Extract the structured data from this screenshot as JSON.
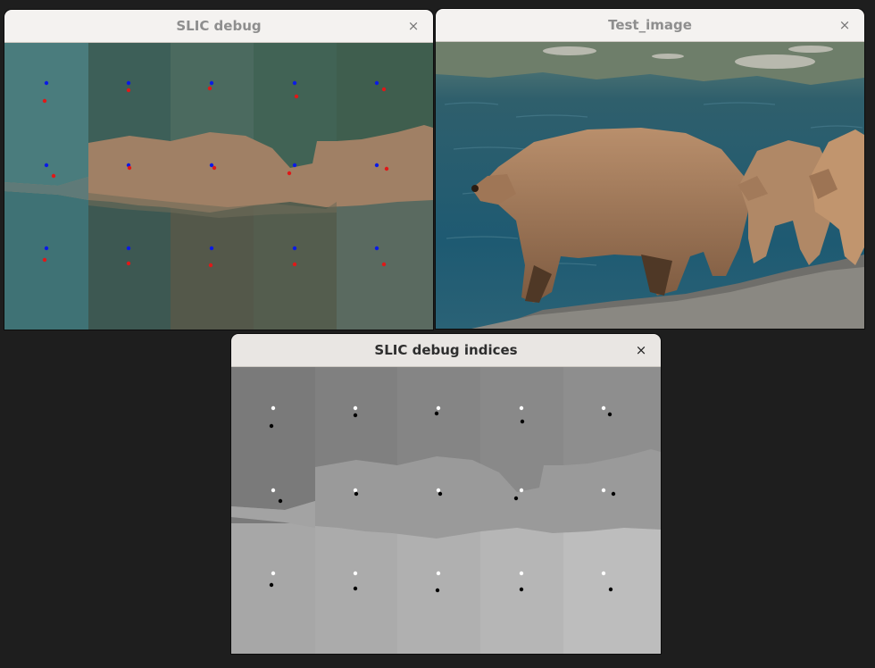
{
  "windows": [
    {
      "id": "slic-debug",
      "title": "SLIC debug",
      "close_glyph": "×",
      "close_icon": "close-icon"
    },
    {
      "id": "test-image",
      "title": "Test_image",
      "close_glyph": "×",
      "close_icon": "close-icon"
    },
    {
      "id": "slic-debug-indices",
      "title": "SLIC debug indices",
      "close_glyph": "×",
      "close_icon": "close-icon"
    }
  ],
  "colors": {
    "desktop": "#1e1e1e",
    "initial_center_marker": "#0a1ae6",
    "converged_center_marker": "#e01818",
    "indices_initial_marker": "#ffffff",
    "indices_converged_marker": "#000000"
  }
}
